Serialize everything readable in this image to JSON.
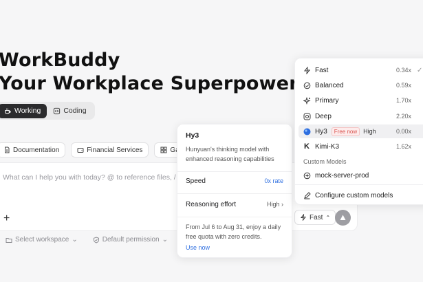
{
  "hero": {
    "line1": "WorkBuddy",
    "line2": "Your Workplace Superpower"
  },
  "modes": [
    {
      "label": "Working",
      "icon": "cup-icon",
      "active": true
    },
    {
      "label": "Coding",
      "icon": "code-icon",
      "active": false
    }
  ],
  "chips": [
    {
      "label": "Documentation",
      "icon": "document-icon"
    },
    {
      "label": "Financial Services",
      "icon": "wallet-icon"
    },
    {
      "label": "Gaokao",
      "icon": "grid-icon"
    }
  ],
  "input": {
    "placeholder": "What can I help you with today? @ to reference files, / to"
  },
  "bottom_bar": {
    "workspace": "Select workspace",
    "permission": "Default permission"
  },
  "fast_button": {
    "label": "Fast"
  },
  "info_card": {
    "title": "Hy3",
    "description": "Hunyuan's thinking model with enhanced reasoning capabilities",
    "speed_label": "Speed",
    "speed_value": "0x rate",
    "reasoning_label": "Reasoning effort",
    "reasoning_value": "High",
    "note": "From Jul 6 to Aug 31, enjoy a daily free quota with zero credits.",
    "link": "Use now"
  },
  "model_menu": {
    "items": [
      {
        "name": "Fast",
        "multiplier": "0.34x",
        "icon": "lightning-icon",
        "checked": true
      },
      {
        "name": "Balanced",
        "multiplier": "0.59x",
        "icon": "balance-check-icon"
      },
      {
        "name": "Primary",
        "multiplier": "1.70x",
        "icon": "sparkle-icon"
      },
      {
        "name": "Deep",
        "multiplier": "2.20x",
        "icon": "deep-icon"
      },
      {
        "name": "Hy3",
        "multiplier": "0.00x",
        "icon": "hy3-logo-icon",
        "badge": "Free now",
        "reasoning": "High",
        "selected": true
      },
      {
        "name": "Kimi-K3",
        "multiplier": "1.62x",
        "icon": "kimi-logo-icon"
      }
    ],
    "custom_section": "Custom Models",
    "custom_item": "mock-server-prod",
    "configure": "Configure custom models"
  }
}
